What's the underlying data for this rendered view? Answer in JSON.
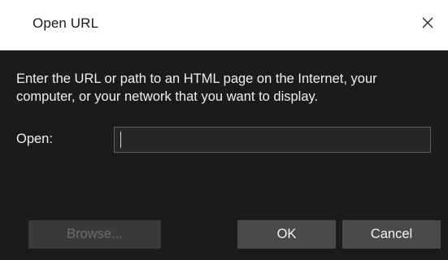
{
  "window": {
    "title": "Open URL",
    "close_icon": "close-icon"
  },
  "content": {
    "description": "Enter the URL or path to an HTML page on the Internet, your computer, or your network that you want to display.",
    "open_label": "Open:",
    "open_value": ""
  },
  "buttons": {
    "browse_label": "Browse...",
    "ok_label": "OK",
    "cancel_label": "Cancel"
  },
  "colors": {
    "panel_bg": "#1b1b1b",
    "button_bg": "#4a4a4a",
    "disabled_text": "#6d6d6d"
  }
}
